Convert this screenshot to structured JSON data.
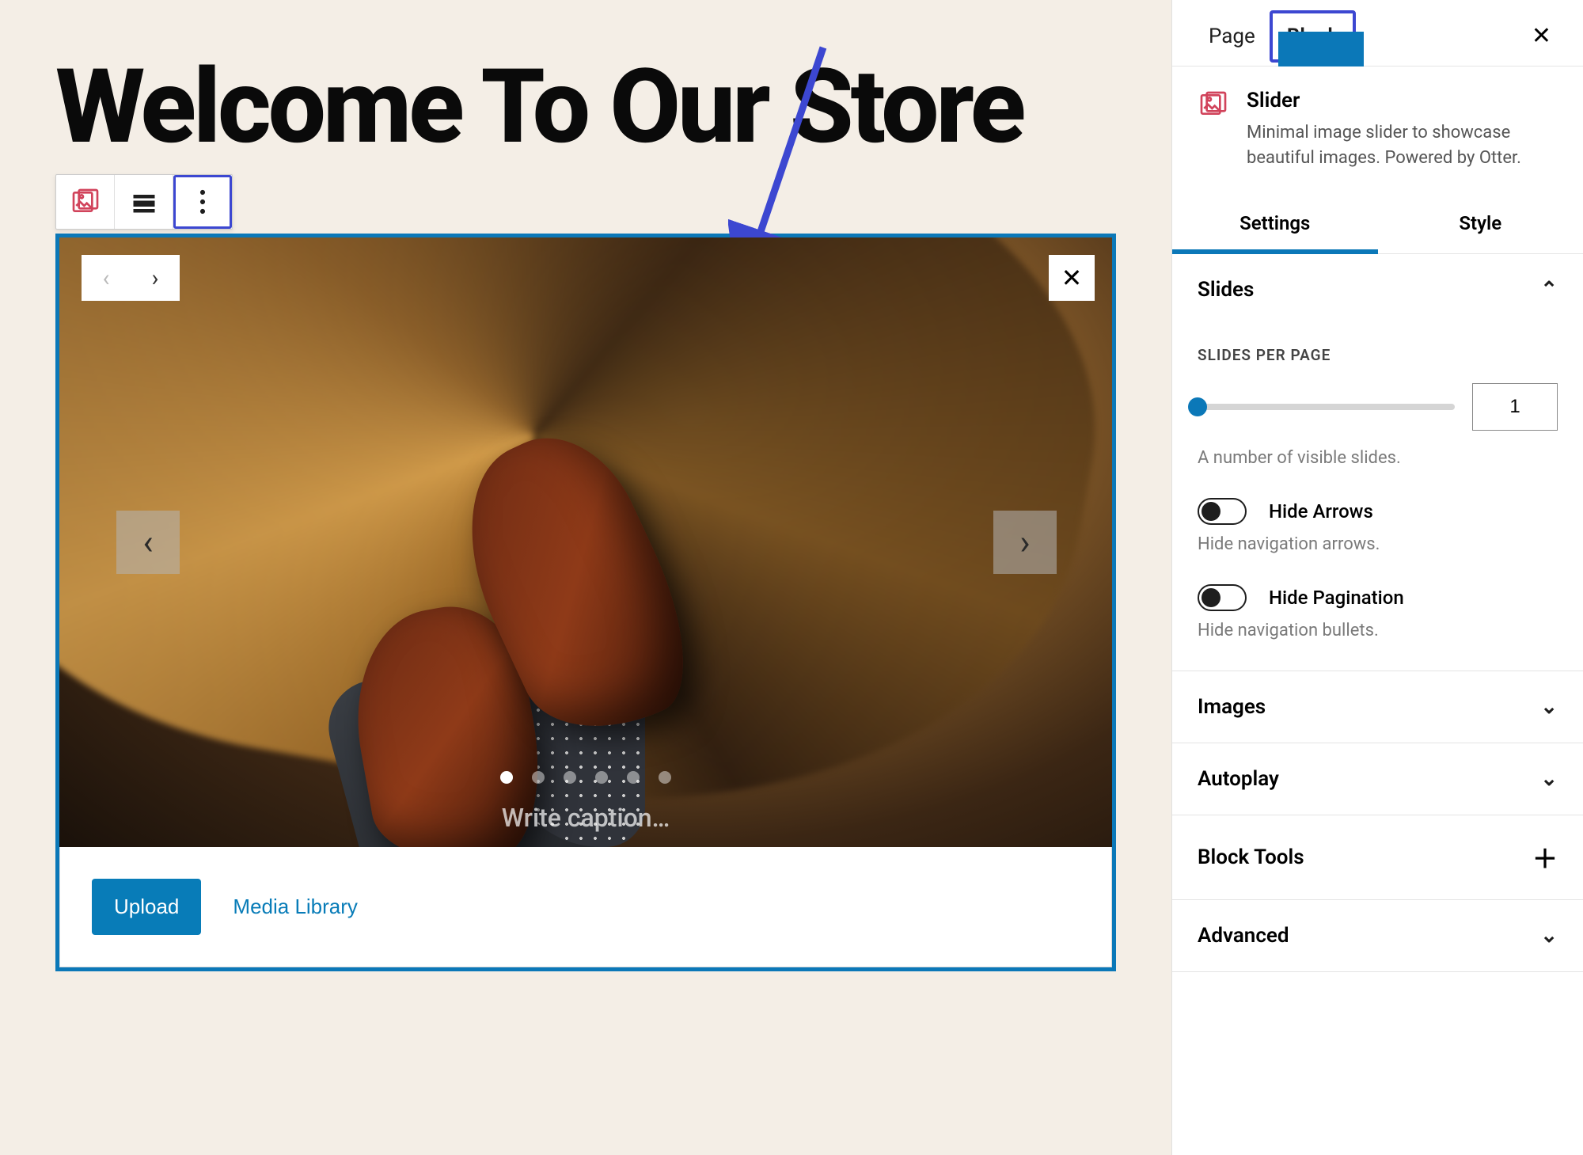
{
  "heading": "Welcome To Our Store",
  "sliderBlock": {
    "captionPlaceholder": "Write caption…",
    "dotCount": 6,
    "activeDot": 0,
    "uploadLabel": "Upload",
    "mediaLibraryLabel": "Media Library"
  },
  "inspector": {
    "tabs": {
      "page": "Page",
      "block": "Block"
    },
    "block": {
      "name": "Slider",
      "description": "Minimal image slider to showcase beautiful images. Powered by Otter."
    },
    "subTabs": {
      "settings": "Settings",
      "style": "Style"
    },
    "panels": {
      "slides": {
        "title": "Slides",
        "slidesPerPage": {
          "label": "SLIDES PER PAGE",
          "value": "1",
          "help": "A number of visible slides."
        },
        "hideArrows": {
          "label": "Hide Arrows",
          "help": "Hide navigation arrows."
        },
        "hidePagination": {
          "label": "Hide Pagination",
          "help": "Hide navigation bullets."
        }
      },
      "images": "Images",
      "autoplay": "Autoplay",
      "blockTools": "Block Tools",
      "advanced": "Advanced"
    }
  }
}
